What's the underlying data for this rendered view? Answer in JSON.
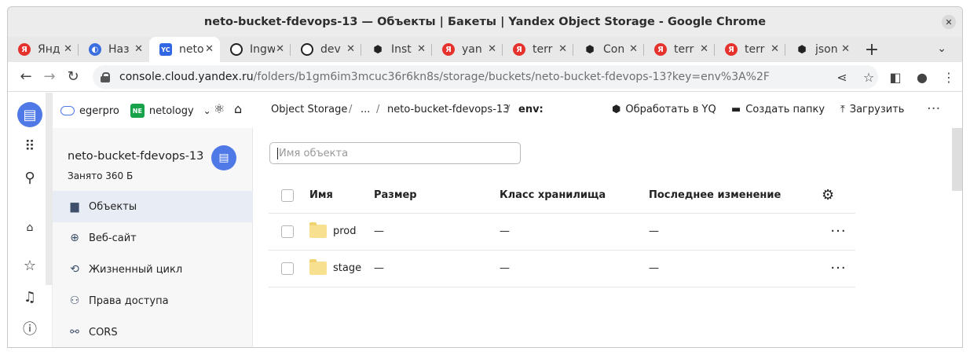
{
  "window": {
    "title": "neto-bucket-fdevops-13 — Объекты | Бакеты | Yandex Object Storage - Google Chrome"
  },
  "tabs": [
    {
      "label": "Янд",
      "favicon": "yandex-icon"
    },
    {
      "label": "Наз",
      "favicon": "edge-icon"
    },
    {
      "label": "neto",
      "favicon": "yandex-cloud-icon",
      "active": true
    },
    {
      "label": "Ingw",
      "favicon": "github-icon"
    },
    {
      "label": "dev",
      "favicon": "github-icon"
    },
    {
      "label": "Inst",
      "favicon": "hashicorp-icon"
    },
    {
      "label": "yan",
      "favicon": "yandex-icon"
    },
    {
      "label": "terr",
      "favicon": "yandex-icon"
    },
    {
      "label": "Con",
      "favicon": "hashicorp-icon"
    },
    {
      "label": "terr",
      "favicon": "yandex-icon"
    },
    {
      "label": "terr",
      "favicon": "yandex-icon"
    },
    {
      "label": "json",
      "favicon": "hashicorp-icon"
    }
  ],
  "address": {
    "host": "console.cloud.yandex.ru",
    "path": "/folders/b1gm6im3mcuc36r6kn8s/storage/buckets/neto-bucket-fdevops-13?key=env%3A%2F"
  },
  "topbar": {
    "account": "egerpro",
    "org_badge": "NE",
    "folder": "netology",
    "service": "Object Storage",
    "ellipsis": "...",
    "bucket": "neto-bucket-fdevops-13",
    "prefix": "env:",
    "action_yq": "Обработать в YQ",
    "action_folder": "Создать папку",
    "action_upload": "Загрузить"
  },
  "sidebar": {
    "bucket_name": "neto-bucket-fdevops-13",
    "bucket_size": "Занято 360 Б",
    "items": [
      {
        "label": "Объекты",
        "icon": "folder-icon",
        "active": true
      },
      {
        "label": "Веб-сайт",
        "icon": "globe-icon"
      },
      {
        "label": "Жизненный цикл",
        "icon": "cycle-icon"
      },
      {
        "label": "Права доступа",
        "icon": "users-icon"
      },
      {
        "label": "CORS",
        "icon": "cors-icon"
      }
    ]
  },
  "search": {
    "placeholder": "Имя объекта"
  },
  "table": {
    "columns": [
      "Имя",
      "Размер",
      "Класс хранилища",
      "Последнее изменение"
    ],
    "rows": [
      {
        "name": "prod",
        "size": "—",
        "class": "—",
        "modified": "—"
      },
      {
        "name": "stage",
        "size": "—",
        "class": "—",
        "modified": "—"
      }
    ]
  },
  "colors": {
    "accent": "#4f79e6",
    "folder": "#f7e08f",
    "active_nav": "#e8ecf5"
  }
}
